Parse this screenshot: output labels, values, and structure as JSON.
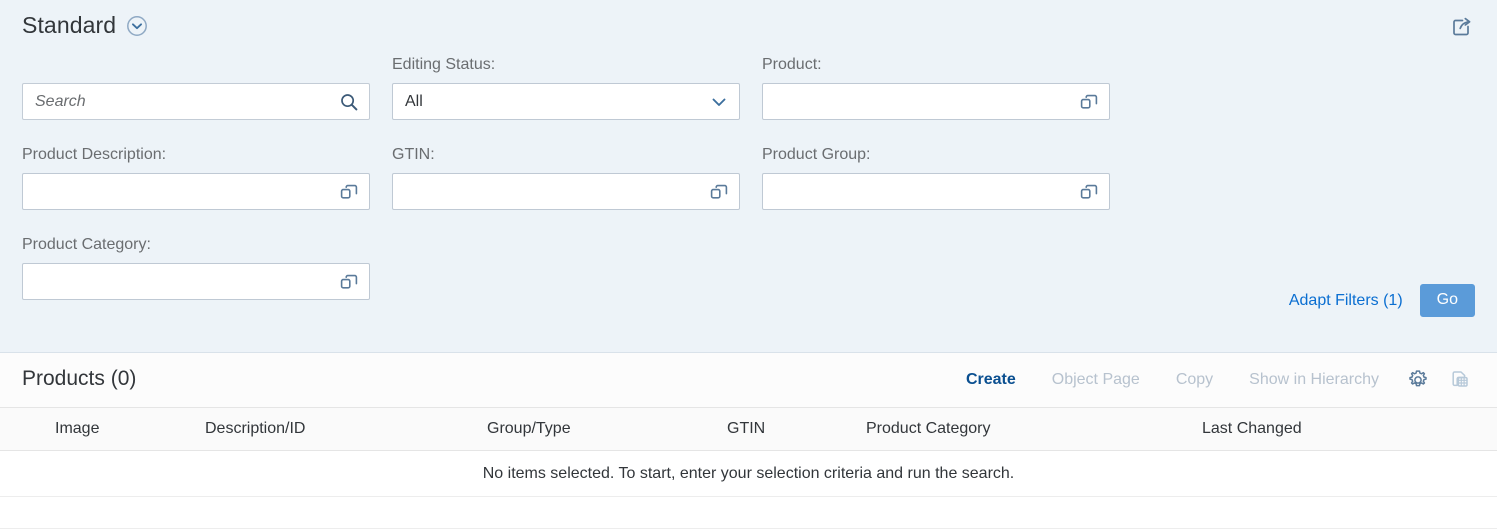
{
  "filter_bar": {
    "variant_title": "Standard",
    "variant_chevron_icon": "chevron-down-circle-icon",
    "share_icon": "share-export-icon",
    "search": {
      "placeholder": "Search",
      "value": "",
      "icon": "search-icon"
    },
    "fields": [
      {
        "label": "Editing Status:",
        "type": "select",
        "value": "All",
        "icon": "chevron-down-icon"
      },
      {
        "label": "Product:",
        "type": "value-help",
        "value": "",
        "icon": "value-help-icon"
      },
      {
        "label": "Product Description:",
        "type": "value-help",
        "value": "",
        "icon": "value-help-icon"
      },
      {
        "label": "GTIN:",
        "type": "value-help",
        "value": "",
        "icon": "value-help-icon"
      },
      {
        "label": "Product Group:",
        "type": "value-help",
        "value": "",
        "icon": "value-help-icon"
      },
      {
        "label": "Product Category:",
        "type": "value-help",
        "value": "",
        "icon": "value-help-icon"
      }
    ],
    "adapt_filters_label": "Adapt Filters (1)",
    "go_label": "Go"
  },
  "table": {
    "title": "Products (0)",
    "actions": [
      {
        "label": "Create",
        "state": "enabled"
      },
      {
        "label": "Object Page",
        "state": "disabled"
      },
      {
        "label": "Copy",
        "state": "disabled"
      },
      {
        "label": "Show in Hierarchy",
        "state": "disabled"
      }
    ],
    "settings_icon": "gear-icon",
    "export_icon": "spreadsheet-export-icon",
    "columns": [
      "Image",
      "Description/ID",
      "Group/Type",
      "GTIN",
      "Product Category",
      "Last Changed"
    ],
    "empty_message": "No items selected. To start, enter your selection criteria and run the search."
  },
  "colors": {
    "filter_bar_bg": "#edf3f8",
    "accent_link": "#0a6ed1",
    "go_button_bg": "#5b9bd9",
    "enabled_action": "#0a4f90",
    "disabled_action": "#b7c2ce",
    "icon_blue": "#5a7a9a",
    "label_gray": "#6a6d70",
    "text_dark": "#32363a"
  }
}
